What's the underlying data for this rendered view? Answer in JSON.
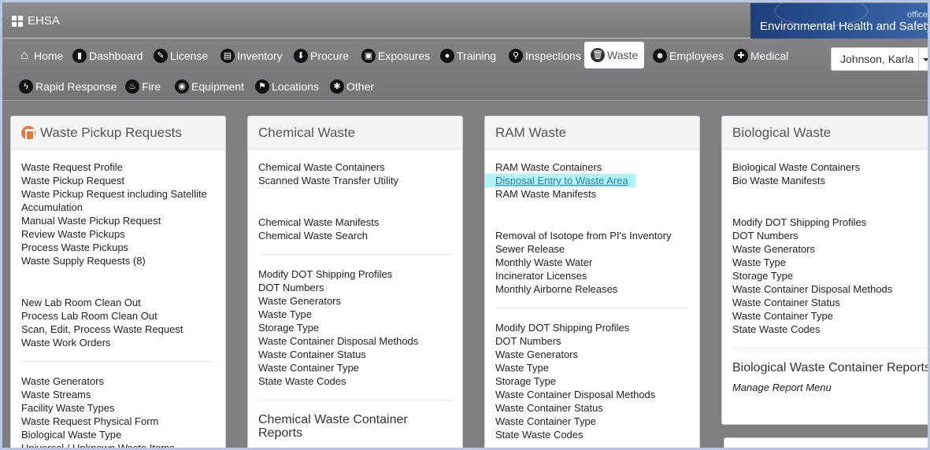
{
  "app": {
    "title": "EHSA",
    "banner_office": "office",
    "banner_title": "Environmental Health and Safety"
  },
  "nav": {
    "home": "Home",
    "dashboard": "Dashboard",
    "license": "License",
    "inventory": "Inventory",
    "procure": "Procure",
    "exposures": "Exposures",
    "training": "Training",
    "inspections": "Inspections",
    "waste": "Waste",
    "employees": "Employees",
    "medical": "Medical",
    "rapid_response": "Rapid Response",
    "fire": "Fire",
    "equipment": "Equipment",
    "locations": "Locations",
    "other": "Other"
  },
  "user": {
    "name": "Johnson, Karla"
  },
  "colors": {
    "highlight": "#aef4f7",
    "link": "#337ab7",
    "waste_icon": "#e8773a"
  },
  "panels": {
    "pickup": {
      "title": "Waste Pickup Requests",
      "group1": [
        "Waste Request Profile",
        "Waste Pickup Request",
        "Waste Pickup Request including Satellite Accumulation",
        "Manual Waste Pickup Request",
        "Review Waste Pickups",
        "Process Waste Pickups",
        "Waste Supply Requests (8)"
      ],
      "group2": [
        "New Lab Room Clean Out",
        "Process Lab Room Clean Out",
        "Scan, Edit, Process Waste Request",
        "Waste Work Orders"
      ],
      "group3": [
        "Waste Generators",
        "Waste Streams",
        "Facility Waste Types",
        "Waste Request Physical Form",
        "Biological Waste Type",
        "Universal / Unknown Waste Items"
      ]
    },
    "chemical": {
      "title": "Chemical Waste",
      "group1": [
        "Chemical Waste Containers",
        "Scanned Waste Transfer Utility"
      ],
      "group2": [
        "Chemical Waste Manifests",
        "Chemical Waste Search"
      ],
      "group3": [
        "Modify DOT Shipping Profiles",
        "DOT Numbers",
        "Waste Generators",
        "Waste Type",
        "Storage Type",
        "Waste Container Disposal Methods",
        "Waste Container Status",
        "Waste Container Type",
        "State Waste Codes"
      ],
      "reports_title": "Chemical Waste Container Reports"
    },
    "ram": {
      "title": "RAM Waste",
      "group1": [
        "RAM Waste Containers",
        "Disposal Entry to Waste Area",
        "RAM Waste Manifests"
      ],
      "group2": [
        "Removal of Isotope from PI's Inventory",
        "Sewer Release",
        "Monthly Waste Water",
        "Incinerator Licenses",
        "Monthly Airborne Releases"
      ],
      "group3": [
        "Modify DOT Shipping Profiles",
        "DOT Numbers",
        "Waste Generators",
        "Waste Type",
        "Storage Type",
        "Waste Container Disposal Methods",
        "Waste Container Status",
        "Waste Container Type",
        "State Waste Codes"
      ]
    },
    "bio": {
      "title": "Biological Waste",
      "group1": [
        "Biological Waste Containers",
        "Bio Waste Manifests"
      ],
      "group2": [
        "Modify DOT Shipping Profiles",
        "DOT Numbers",
        "Waste Generators",
        "Waste Type",
        "Storage Type",
        "Waste Container Disposal Methods",
        "Waste Container Status",
        "Waste Container Type",
        "State Waste Codes"
      ],
      "reports_title": "Biological Waste Container Reports",
      "reports_link": "Manage Report Menu"
    }
  }
}
